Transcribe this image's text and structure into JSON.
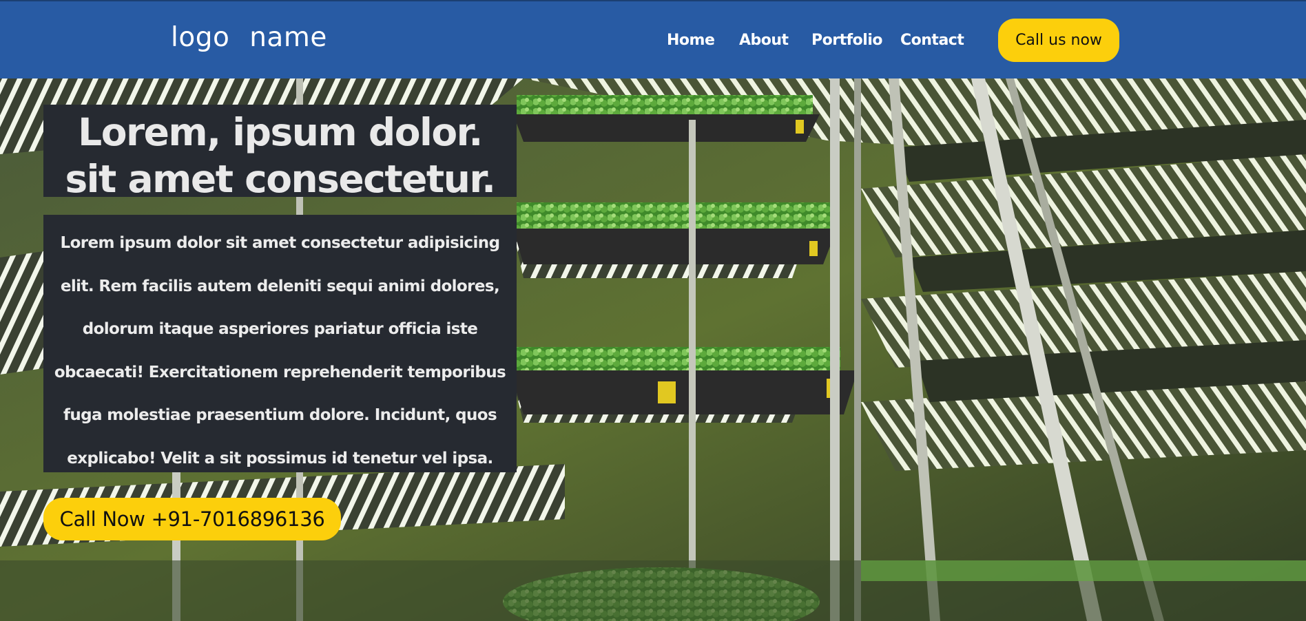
{
  "header": {
    "logo": "logo  name",
    "nav": [
      {
        "label": "Home"
      },
      {
        "label": "About"
      },
      {
        "label": "Portfolio"
      },
      {
        "label": "Contact"
      }
    ],
    "cta_label": "Call us now"
  },
  "hero": {
    "headline_line1": "Lorem, ipsum dolor.",
    "headline_line2": "sit amet consectetur.",
    "description": "Lorem ipsum dolor sit amet consectetur adipisicing elit. Rem facilis autem deleniti sequi animi dolores, dolorum itaque asperiores pariatur officia iste obcaecati! Exercitationem reprehenderit temporibus fuga molestiae praesentium dolore. Incidunt, quos explicabo! Velit a sit possimus id tenetur vel ipsa.",
    "call_button": "Call Now +91-7016896136",
    "background_image": "vertical-farm-racks"
  },
  "colors": {
    "header_bg": "#285ba4",
    "accent": "#fccf0c",
    "panel_bg": "#262a31",
    "text_light": "#ffffff"
  }
}
